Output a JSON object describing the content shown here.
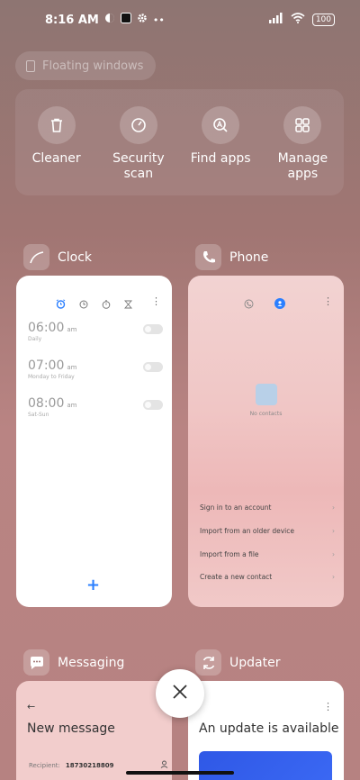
{
  "status": {
    "time": "8:16 AM",
    "battery": "100"
  },
  "floating": {
    "label": "Floating windows"
  },
  "quick_actions": [
    {
      "label": "Cleaner",
      "icon": "trash-icon"
    },
    {
      "label": "Security\nscan",
      "icon": "security-icon"
    },
    {
      "label": "Find apps",
      "icon": "find-apps-icon"
    },
    {
      "label": "Manage\napps",
      "icon": "grid-icon"
    }
  ],
  "apps": {
    "clock": {
      "name": "Clock",
      "alarms": [
        {
          "time": "06:00",
          "ampm": "am",
          "repeat": "Daily"
        },
        {
          "time": "07:00",
          "ampm": "am",
          "repeat": "Monday to Friday"
        },
        {
          "time": "08:00",
          "ampm": "am",
          "repeat": "Sat-Sun"
        }
      ],
      "add": "+"
    },
    "phone": {
      "name": "Phone",
      "empty": "No contacts",
      "menu": [
        "Sign in to an account",
        "Import from an older device",
        "Import from a file",
        "Create a new contact"
      ]
    },
    "messaging": {
      "name": "Messaging",
      "title": "New message",
      "recipient_label": "Recipient:",
      "recipient": "18730218809"
    },
    "updater": {
      "name": "Updater",
      "title": "An update is available"
    }
  },
  "colors": {
    "accent": "#2b7fff",
    "update_banner": "#3160ec"
  }
}
